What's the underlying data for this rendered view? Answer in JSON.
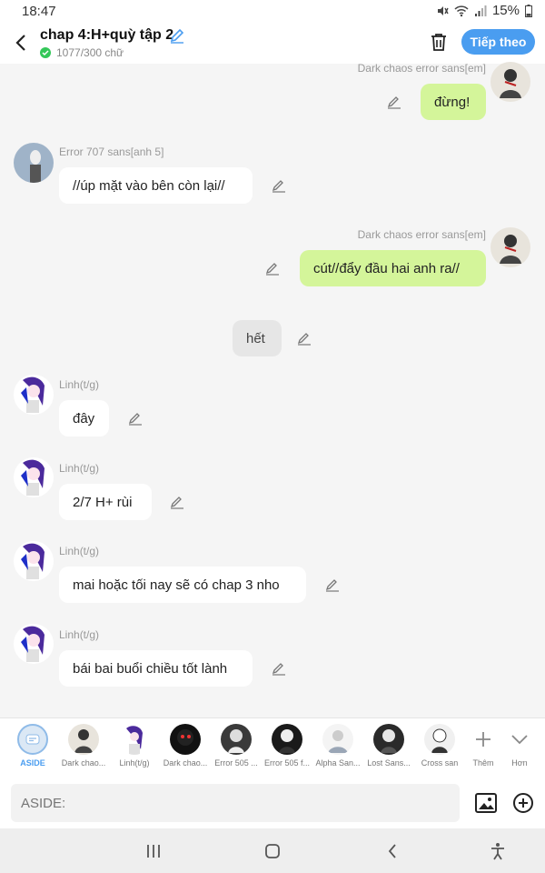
{
  "status_bar": {
    "time": "18:47",
    "battery": "15%"
  },
  "header": {
    "title": "chap 4:H+quỳ tập 2",
    "word_count": "1077/300 chữ",
    "next_label": "Tiếp theo",
    "accent": "#4a9df0"
  },
  "messages": [
    {
      "sender": "Dark chaos error sans[em]",
      "text": "đừng!",
      "side": "right"
    },
    {
      "sender": "Error 707 sans[anh 5]",
      "text": "//úp mặt vào bên còn lại//",
      "side": "left"
    },
    {
      "sender": "Dark chaos error sans[em]",
      "text": "cút//đẩy đầu hai anh ra//",
      "side": "right"
    },
    {
      "sender": "",
      "text": "hết",
      "side": "center"
    },
    {
      "sender": "Linh(t/g)",
      "text": "đây",
      "side": "left"
    },
    {
      "sender": "Linh(t/g)",
      "text": "2/7 H+ rùi",
      "side": "left"
    },
    {
      "sender": "Linh(t/g)",
      "text": "mai hoặc tối nay sẽ có chap 3 nho",
      "side": "left"
    },
    {
      "sender": "Linh(t/g)",
      "text": "bái bai buổi chiều tốt lành",
      "side": "left"
    }
  ],
  "characters": [
    {
      "label": "ASIDE"
    },
    {
      "label": "Dark chao..."
    },
    {
      "label": "Linh(t/g)"
    },
    {
      "label": "Dark chao..."
    },
    {
      "label": "Error 505 ..."
    },
    {
      "label": "Error 505 f..."
    },
    {
      "label": "Alpha San..."
    },
    {
      "label": "Lost Sans..."
    },
    {
      "label": "Cross san"
    }
  ],
  "more_label": "Thêm",
  "less_label": "Hơn",
  "input": {
    "placeholder": "ASIDE:"
  },
  "colors": {
    "right_bubble": "#d4f59a",
    "left_bubble": "#ffffff",
    "center_bubble": "#e6e6e6"
  }
}
